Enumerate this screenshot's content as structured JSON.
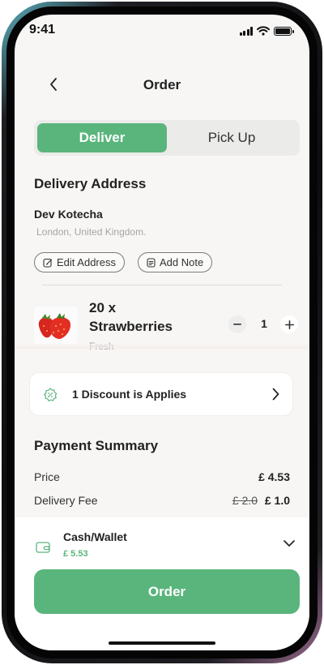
{
  "status_bar": {
    "time": "9:41"
  },
  "header": {
    "title": "Order"
  },
  "segment": {
    "deliver_label": "Deliver",
    "pickup_label": "Pick Up",
    "selected": "Deliver"
  },
  "address": {
    "section_title": "Delivery Address",
    "name": "Dev Kotecha",
    "location": "London, United Kingdom.",
    "edit_label": "Edit Address",
    "note_label": "Add Note"
  },
  "item": {
    "title": "20 x Strawberries",
    "subtitle": "Fresh",
    "quantity": "1"
  },
  "discount": {
    "text": "1 Discount is Applies"
  },
  "payment": {
    "section_title": "Payment Summary",
    "price_label": "Price",
    "price_value": "£ 4.53",
    "delivery_label": "Delivery Fee",
    "delivery_old": "£ 2.0",
    "delivery_new": "£ 1.0"
  },
  "wallet": {
    "title": "Cash/Wallet",
    "amount": "£ 5.53"
  },
  "order_button": {
    "label": "Order"
  },
  "colors": {
    "accent": "#5ab57c",
    "background": "#f7f6f5"
  }
}
